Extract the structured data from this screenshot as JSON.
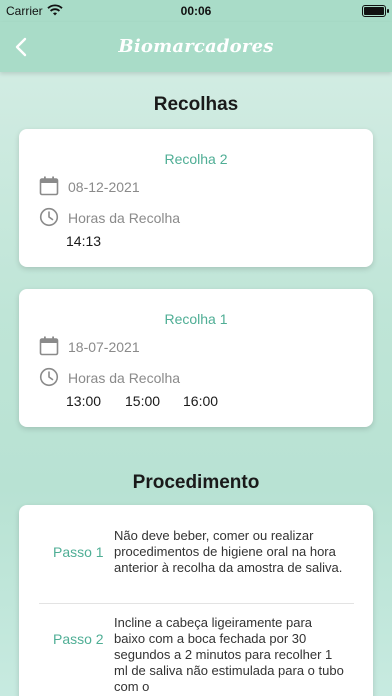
{
  "status_bar": {
    "carrier": "Carrier",
    "time": "00:06"
  },
  "nav": {
    "title": "Biomarcadores"
  },
  "sections": {
    "collections_title": "Recolhas",
    "procedure_title": "Procedimento"
  },
  "collections": [
    {
      "title": "Recolha 2",
      "date": "08-12-2021",
      "hours_label": "Horas da Recolha",
      "hours": [
        "14:13"
      ]
    },
    {
      "title": "Recolha 1",
      "date": "18-07-2021",
      "hours_label": "Horas da Recolha",
      "hours": [
        "13:00",
        "15:00",
        "16:00"
      ]
    }
  ],
  "procedure": [
    {
      "label": "Passo 1",
      "text": "Não deve beber, comer ou realizar procedimentos de higiene oral na hora anterior à recolha da amostra de saliva."
    },
    {
      "label": "Passo 2",
      "text": "Incline a cabeça ligeiramente para baixo com a boca fechada por 30 segundos a 2 minutos para recolher 1 ml de saliva não estimulada para o tubo com o"
    }
  ],
  "colors": {
    "accent": "#4fae95",
    "nav_bg": "#a9dcc8"
  }
}
